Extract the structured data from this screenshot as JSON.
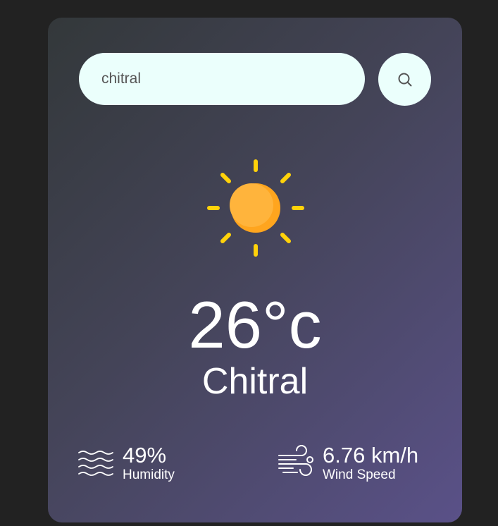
{
  "search": {
    "value": "chitral",
    "icon": "search-icon"
  },
  "weather": {
    "icon": "sun-icon",
    "temperature": "26°c",
    "city": "Chitral"
  },
  "details": {
    "humidity": {
      "value": "49%",
      "label": "Humidity",
      "icon": "humidity-icon"
    },
    "wind": {
      "value": "6.76 km/h",
      "label": "Wind Speed",
      "icon": "wind-icon"
    }
  },
  "colors": {
    "page_background": "#222222",
    "card_gradient_start": "#33383a",
    "card_gradient_end": "#5a5188",
    "search_background": "#ebfffc",
    "sun_rays": "#ffd20a",
    "sun_body": "#ffb43c"
  }
}
